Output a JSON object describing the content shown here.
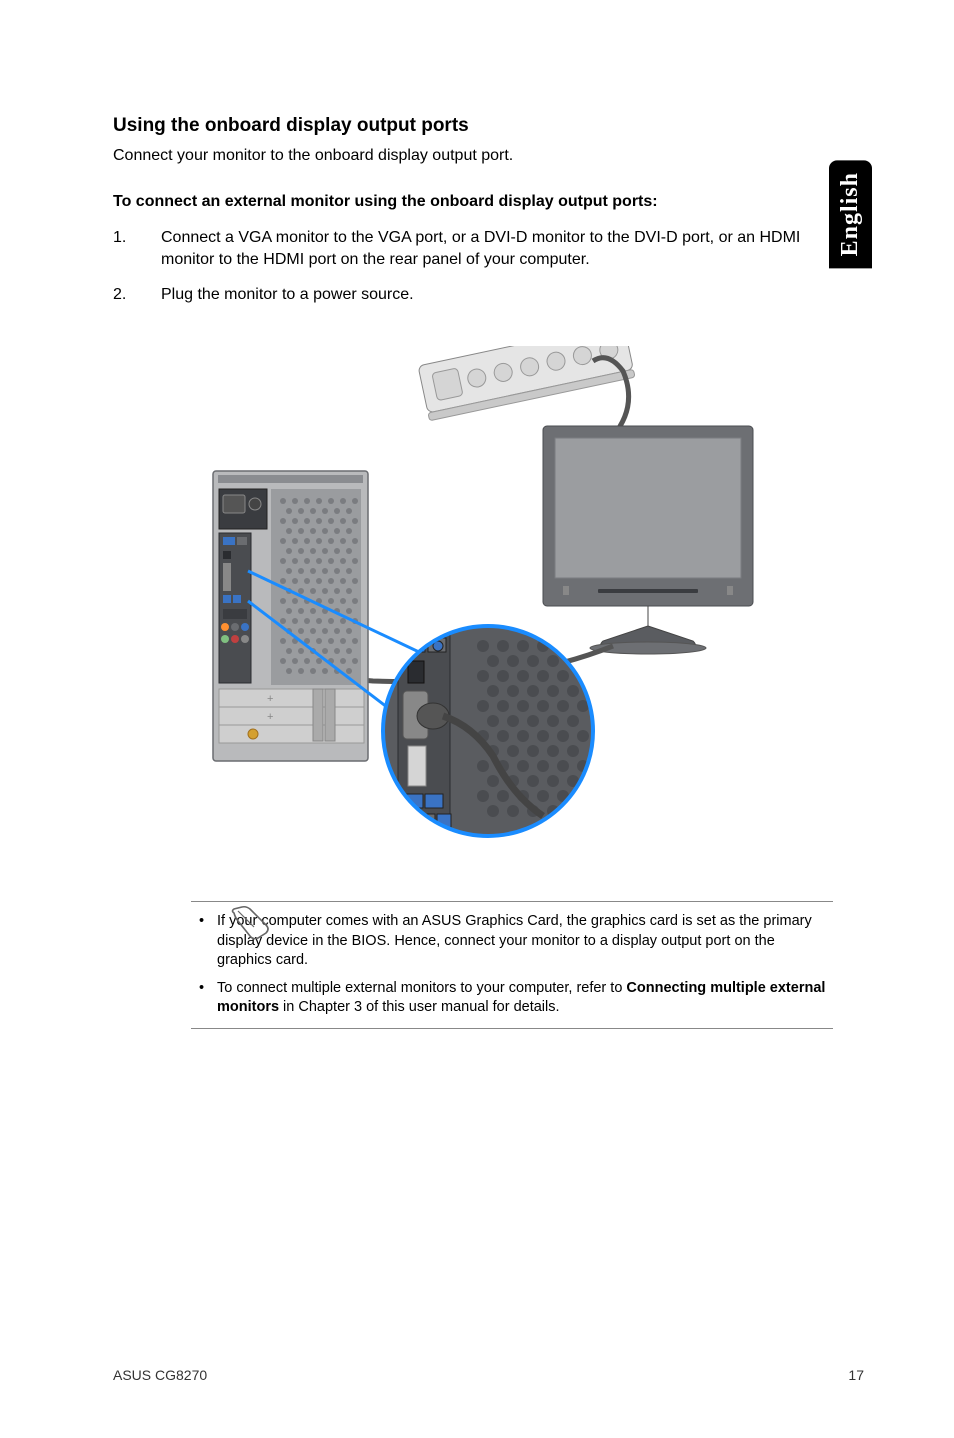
{
  "language_tab": "English",
  "heading": "Using the onboard display output ports",
  "intro": "Connect your monitor to the onboard display output port.",
  "sub_heading": "To connect an external monitor using the onboard display output ports:",
  "steps": [
    {
      "num": "1.",
      "text": "Connect a VGA monitor to the VGA port, or a DVI-D monitor to the DVI-D port, or an HDMI monitor to the HDMI port on the rear panel of your computer."
    },
    {
      "num": "2.",
      "text": "Plug the monitor to a power source."
    }
  ],
  "notes": [
    {
      "bullet": "•",
      "text_parts": [
        "If your computer comes with an ASUS Graphics Card, the graphics card is set as the primary display device in the BIOS. Hence, connect your monitor to a display output port on the graphics card."
      ]
    },
    {
      "bullet": "•",
      "text_parts": [
        "To connect multiple external monitors to your computer, refer to ",
        "Connecting multiple external monitors",
        " in Chapter 3 of this user manual for details."
      ]
    }
  ],
  "footer_left": "ASUS CG8270",
  "footer_right": "17",
  "colors": {
    "callout_line": "#1a8cff",
    "circle_stroke": "#1a8cff",
    "tower_fill": "#b9babc",
    "tower_dark": "#5a5c60",
    "monitor_bezel": "#6d6f73",
    "monitor_screen": "#9b9da0",
    "strip_fill": "#e5e5e5"
  }
}
